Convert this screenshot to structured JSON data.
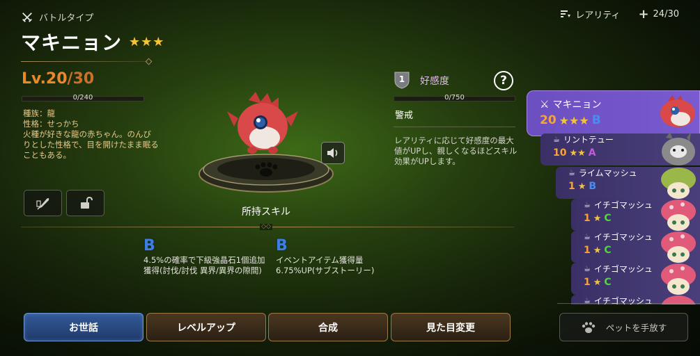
{
  "header": {
    "battle_type": "バトルタイプ",
    "pet_name": "マキニョン",
    "stars": 3,
    "rarity_filter": "レアリティ",
    "capacity": "24/30"
  },
  "level": {
    "current": "Lv.20",
    "max": "/30",
    "exp_text": "0/240",
    "exp_progress": 0
  },
  "description": {
    "species": "種族：龍",
    "personality": "性格：せっかち",
    "flavor": "火種が好きな龍の赤ちゃん。のんびりとした性格で、目を開けたまま眠ることもある。"
  },
  "skills": {
    "title": "所持スキル",
    "items": [
      {
        "rank": "B",
        "text": "4.5%の確率で下級強晶石1個追加獲得(討伐/討伐 異界/異界の隙間)"
      },
      {
        "rank": "B",
        "text": "イベントアイテム獲得量6.75%UP(サブストーリー)"
      }
    ]
  },
  "affection": {
    "level": "1",
    "label": "好感度",
    "help": "?",
    "bar_text": "0/750",
    "progress": 0,
    "status": "警戒",
    "desc": "レアリティに応じて好感度の最大値がUPし、親しくなるほどスキル効果がUPします。"
  },
  "actions": {
    "care": "お世話",
    "level_up": "レベルアップ",
    "merge": "合成",
    "appearance": "見た目変更",
    "release": "ペットを手放す"
  },
  "pet_list": [
    {
      "name": "マキニョン",
      "level": "20",
      "stars": 3,
      "rank": "B",
      "selected": true,
      "color": "#d9494a"
    },
    {
      "name": "リントテュー",
      "level": "10",
      "stars": 2,
      "rank": "A",
      "selected": false,
      "color": "#8a8a8a"
    },
    {
      "name": "ライムマッシュ",
      "level": "1",
      "stars": 1,
      "rank": "B",
      "selected": false,
      "color": "#9ab84a"
    },
    {
      "name": "イチゴマッシュ",
      "level": "1",
      "stars": 1,
      "rank": "C",
      "selected": false,
      "color": "#e25a7a"
    },
    {
      "name": "イチゴマッシュ",
      "level": "1",
      "stars": 1,
      "rank": "C",
      "selected": false,
      "color": "#e25a7a"
    },
    {
      "name": "イチゴマッシュ",
      "level": "1",
      "stars": 1,
      "rank": "C",
      "selected": false,
      "color": "#e25a7a"
    },
    {
      "name": "イチゴマッシュ",
      "level": "",
      "stars": 0,
      "rank": "",
      "selected": false,
      "color": "#e25a7a"
    }
  ]
}
